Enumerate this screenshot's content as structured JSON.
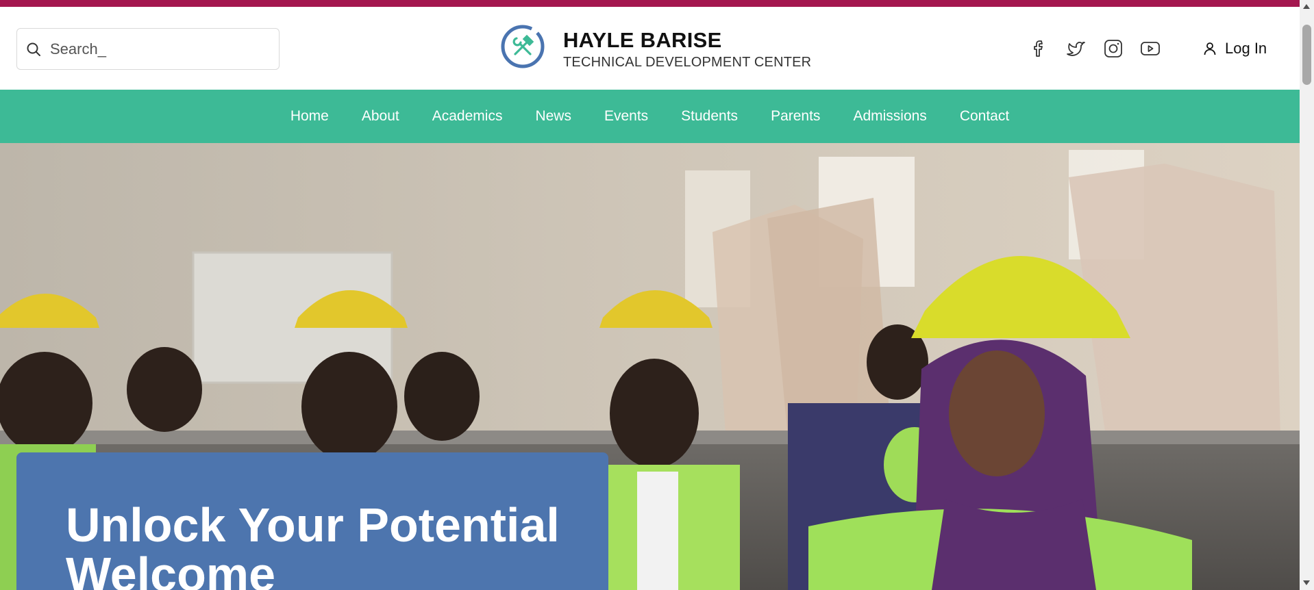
{
  "colors": {
    "top_bar": "#a4174f",
    "nav_background": "#3dba96",
    "hero_card": "#4d75ae",
    "logo_ring": "#4a74b0",
    "logo_icon": "#3dba96"
  },
  "search": {
    "placeholder": "Search_",
    "icon": "search-icon"
  },
  "brand": {
    "logo_icon": "hammer-wrench-icon",
    "title": "HAYLE BARISE",
    "subtitle": "TECHNICAL DEVELOPMENT CENTER"
  },
  "socials": [
    {
      "icon": "facebook-icon"
    },
    {
      "icon": "twitter-icon"
    },
    {
      "icon": "instagram-icon"
    },
    {
      "icon": "youtube-icon"
    }
  ],
  "login": {
    "label": "Log In",
    "icon": "user-icon"
  },
  "nav": {
    "items": [
      {
        "label": "Home"
      },
      {
        "label": "About"
      },
      {
        "label": "Academics"
      },
      {
        "label": "News"
      },
      {
        "label": "Events"
      },
      {
        "label": "Students"
      },
      {
        "label": "Parents"
      },
      {
        "label": "Admissions"
      },
      {
        "label": "Contact"
      }
    ]
  },
  "hero": {
    "heading": "Unlock Your Potential Welcome"
  }
}
